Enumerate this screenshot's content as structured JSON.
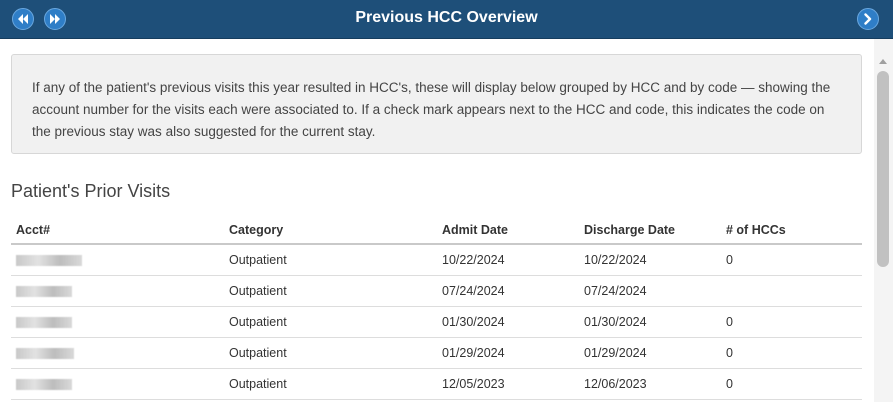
{
  "header": {
    "title": "Previous HCC Overview",
    "icons": {
      "first": "double-left-arrow-icon",
      "prev": "double-right-arrow-icon",
      "next": "chevron-right-icon"
    },
    "accent": "#1e4f79"
  },
  "info": {
    "text": "If any of the patient's previous visits this year resulted in HCC's, these will display below grouped by HCC and by code — showing the account number for the visits each were associated to. If a check mark appears next to the HCC and code, this indicates the code on the previous stay was also suggested for the current stay."
  },
  "section": {
    "title": "Patient's Prior Visits"
  },
  "table": {
    "columns": [
      "Acct#",
      "Category",
      "Admit Date",
      "Discharge Date",
      "# of HCCs"
    ],
    "rows": [
      {
        "acct": "1000007",
        "category": "Outpatient",
        "admit": "10/22/2024",
        "discharge": "10/22/2024",
        "hccs": "0"
      },
      {
        "acct": "10000003",
        "category": "Outpatient",
        "admit": "07/24/2024",
        "discharge": "07/24/2024",
        "hccs": ""
      },
      {
        "acct": "10000007",
        "category": "Outpatient",
        "admit": "01/30/2024",
        "discharge": "01/30/2024",
        "hccs": "0"
      },
      {
        "acct": "100000007",
        "category": "Outpatient",
        "admit": "01/29/2024",
        "discharge": "01/29/2024",
        "hccs": "0"
      },
      {
        "acct": "10000000",
        "category": "Outpatient",
        "admit": "12/05/2023",
        "discharge": "12/06/2023",
        "hccs": "0"
      }
    ]
  }
}
